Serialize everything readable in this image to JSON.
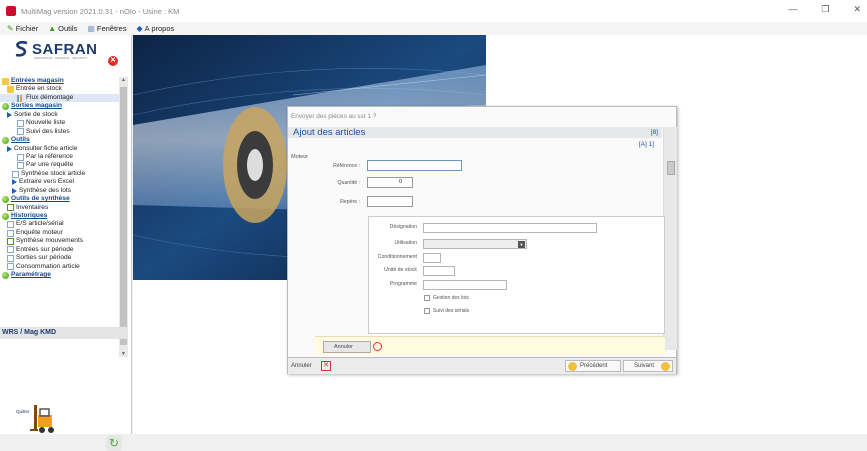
{
  "window": {
    "title": "MultiMag version 2021.0.31 - nOIo - Usine : KM",
    "controls": {
      "minimize": "—",
      "maximize": "❐",
      "close": "✕"
    }
  },
  "menu": [
    {
      "label": "Fichier",
      "icon": "pencil-icon"
    },
    {
      "label": "Outils",
      "icon": "tools-icon"
    },
    {
      "label": "Fenêtres",
      "icon": "windows-icon"
    },
    {
      "label": "A propos",
      "icon": "bird-icon"
    }
  ],
  "sidebar": {
    "logo": {
      "brand": "SAFRAN",
      "tagline": "AEROSPACE · DEFENCE · SECURITY"
    },
    "close_glyph": "✕",
    "tree": [
      {
        "label": "Entrées magasin",
        "kind": "section",
        "icon": "folder-open-icon",
        "indent": 0
      },
      {
        "label": "Entrée en stock",
        "kind": "folder",
        "icon": "folder-icon",
        "indent": 1
      },
      {
        "label": "Flux démontage",
        "kind": "item",
        "icon": "chart-icon",
        "indent": 3,
        "selected": true
      },
      {
        "label": "Sorties magasin",
        "kind": "section",
        "icon": "ball-icon",
        "indent": 0
      },
      {
        "label": "Sortie de stock",
        "kind": "arrow",
        "icon": "arrow-icon",
        "indent": 1
      },
      {
        "label": "Nouvelle liste",
        "kind": "item",
        "icon": "doc-icon",
        "indent": 3
      },
      {
        "label": "Suivi des listes",
        "kind": "item",
        "icon": "doc-icon",
        "indent": 3
      },
      {
        "label": "Outils",
        "kind": "section",
        "icon": "ball-icon",
        "indent": 0
      },
      {
        "label": "Consulter fiche article",
        "kind": "arrow",
        "icon": "arrow-icon",
        "indent": 1
      },
      {
        "label": "Par la référence",
        "kind": "item",
        "icon": "doc-icon",
        "indent": 3
      },
      {
        "label": "Par une requête",
        "kind": "item",
        "icon": "doc-icon",
        "indent": 3
      },
      {
        "label": "Synthèse stock article",
        "kind": "item",
        "icon": "list-icon",
        "indent": 2
      },
      {
        "label": "Extraire vers Excel",
        "kind": "arrow",
        "icon": "arrow-icon",
        "indent": 2
      },
      {
        "label": "Synthèse des lots",
        "kind": "arrow",
        "icon": "arrow-icon",
        "indent": 2
      },
      {
        "label": "Outils de synthèse",
        "kind": "section",
        "icon": "ball-icon",
        "indent": 0
      },
      {
        "label": "Inventaires",
        "kind": "item",
        "icon": "sheet-icon",
        "indent": 1
      },
      {
        "label": "Historiques",
        "kind": "section",
        "icon": "ball-icon",
        "indent": 0
      },
      {
        "label": "E/S article/sérial",
        "kind": "item",
        "icon": "doc-icon",
        "indent": 1
      },
      {
        "label": "Enquête moteur",
        "kind": "item",
        "icon": "doc-icon",
        "indent": 1
      },
      {
        "label": "Synthèse mouvements",
        "kind": "item",
        "icon": "sheet-icon",
        "indent": 1
      },
      {
        "label": "Entrées sur période",
        "kind": "item",
        "icon": "doc-icon",
        "indent": 1
      },
      {
        "label": "Sorties sur période",
        "kind": "item",
        "icon": "doc-icon",
        "indent": 1
      },
      {
        "label": "Consommation article",
        "kind": "item",
        "icon": "doc-icon",
        "indent": 1
      },
      {
        "label": "Paramétrage",
        "kind": "section",
        "icon": "ball-icon",
        "indent": 0
      }
    ],
    "status": "WRS / Mag KMD",
    "quit_label": "Quitter"
  },
  "dialog": {
    "window_title": "Envoyer des pièces au sst 1 ?",
    "header": "Ajout des articles",
    "count": "[8]",
    "sub_count": "[A] 1]",
    "section": "Moteur",
    "fields": {
      "reference_label": "Référence :",
      "reference_value": "",
      "quantite_label": "Quantité :",
      "quantite_value": "0",
      "repere_label": "Repère :",
      "repere_value": ""
    },
    "details": {
      "designation_label": "Désignation",
      "utilisation_label": "Utilisation",
      "conditionnement_label": "Conditionnement",
      "unite_label": "Unité de stock",
      "programme_label": "Programme",
      "gestion_lots": "Gestion des lots",
      "suivi_serials": "Suivi des sérials"
    },
    "inner_cancel": "Annuler",
    "footer": {
      "cancel": "Annuler",
      "cancel_glyph": "✕",
      "previous": "Précédent",
      "next": "Suivant"
    }
  },
  "colors": {
    "accent_blue": "#1f4fa0",
    "safran_navy": "#1e3a6e",
    "section_green": "#3c9a18",
    "cancel_red": "#d9342b",
    "button_bar_yellow": "#fffbe0"
  }
}
